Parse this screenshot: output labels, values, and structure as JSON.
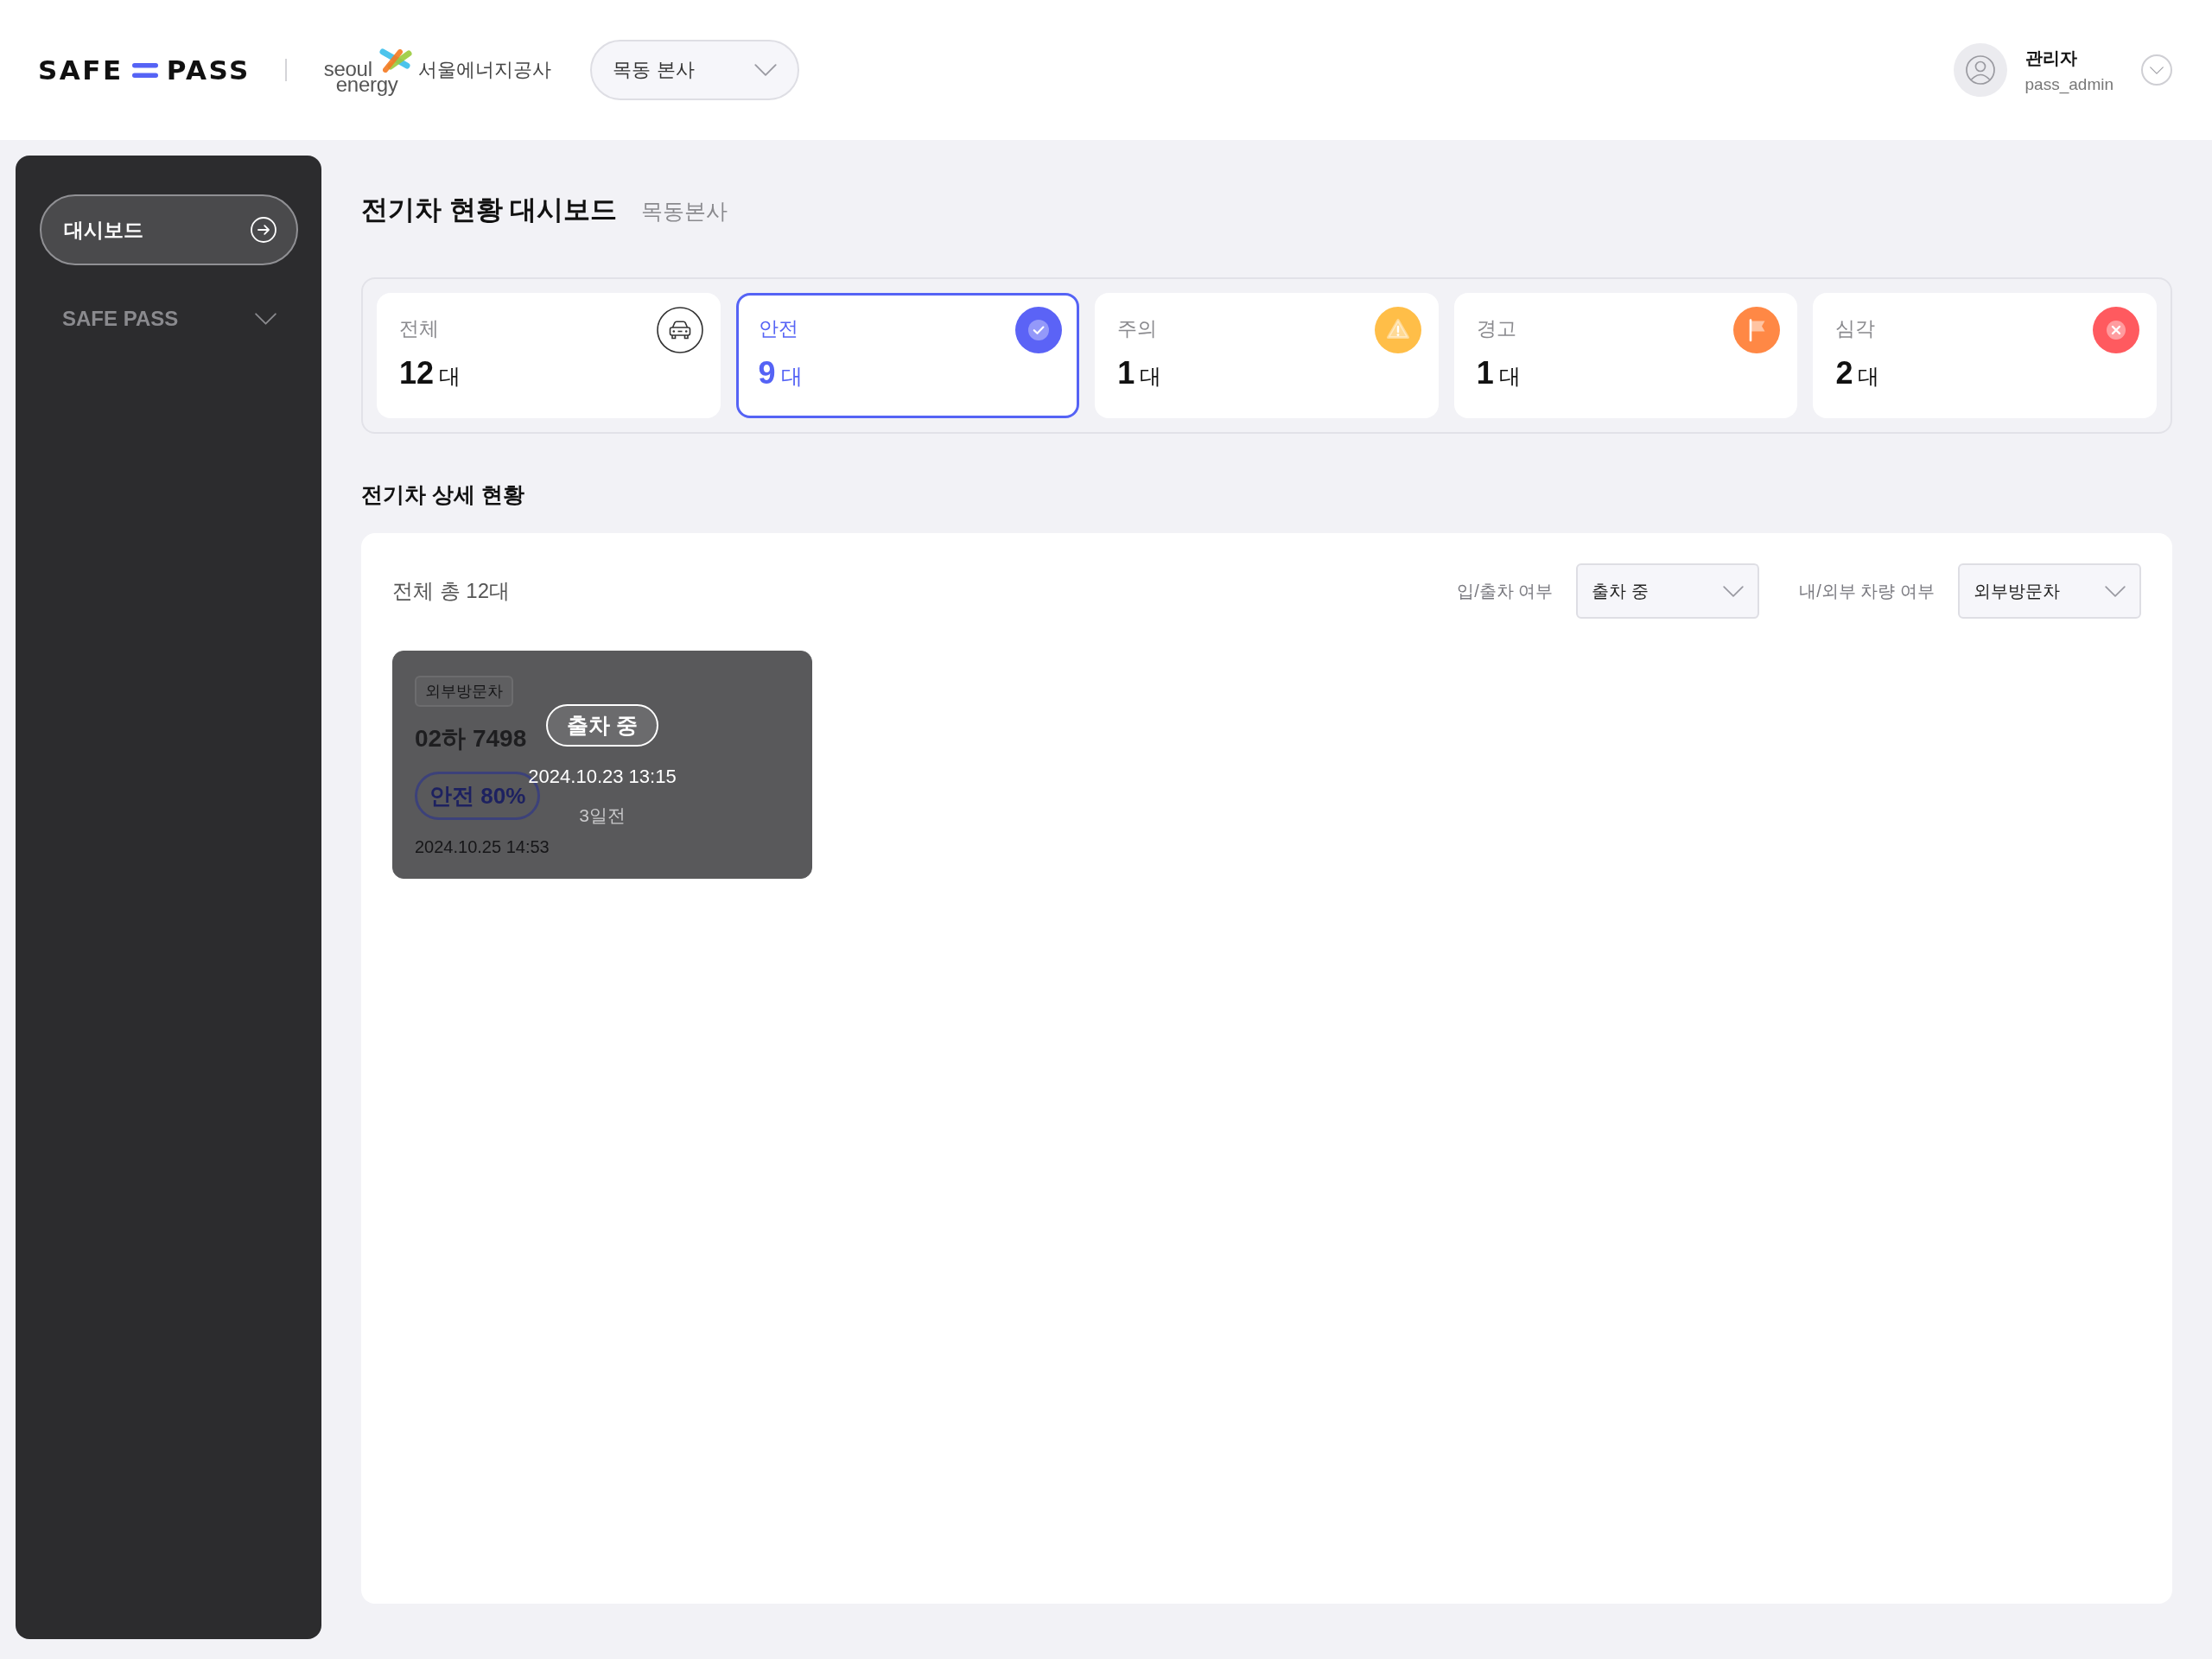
{
  "header": {
    "logo": {
      "left": "SAFE",
      "right": "PASS"
    },
    "org_logo": {
      "latin_top": "seoul",
      "latin_bottom": "energy",
      "name": "서울에너지공사"
    },
    "branch_select": {
      "value": "목동 본사"
    },
    "user": {
      "name": "관리자",
      "id": "pass_admin"
    }
  },
  "sidebar": {
    "items": [
      {
        "kind": "link",
        "label": "대시보드",
        "selected": true
      },
      {
        "kind": "group",
        "label": "SAFE PASS",
        "selected": false,
        "expanded": false
      }
    ]
  },
  "page": {
    "title": "전기차 현황 대시보드",
    "subtitle": "목동본사"
  },
  "summary_cards": [
    {
      "kind": "total",
      "label": "전체",
      "count": "12",
      "unit": "대",
      "selected": false
    },
    {
      "kind": "safe",
      "label": "안전",
      "count": "9",
      "unit": "대",
      "selected": true,
      "color": "#5b63f6"
    },
    {
      "kind": "caution",
      "label": "주의",
      "count": "1",
      "unit": "대",
      "selected": false,
      "color": "#ffbe48"
    },
    {
      "kind": "warning",
      "label": "경고",
      "count": "1",
      "unit": "대",
      "selected": false,
      "color": "#ff8845"
    },
    {
      "kind": "critical",
      "label": "심각",
      "count": "2",
      "unit": "대",
      "selected": false,
      "color": "#ff5a5f"
    }
  ],
  "detail": {
    "title": "전기차 상세 현황",
    "total": "전체 총 12대",
    "filters": [
      {
        "label": "입/출차 여부",
        "value": "출차 중"
      },
      {
        "label": "내/외부 차량 여부",
        "value": "외부방문차"
      }
    ],
    "vehicles": [
      {
        "tag": "외부방문차",
        "plate": "02하 7498",
        "safety": "안전 80%",
        "time": "2024.10.25 14:53",
        "overlay": {
          "status": "출차 중",
          "time": "2024.10.23 13:15",
          "ago": "3일전"
        }
      }
    ]
  }
}
